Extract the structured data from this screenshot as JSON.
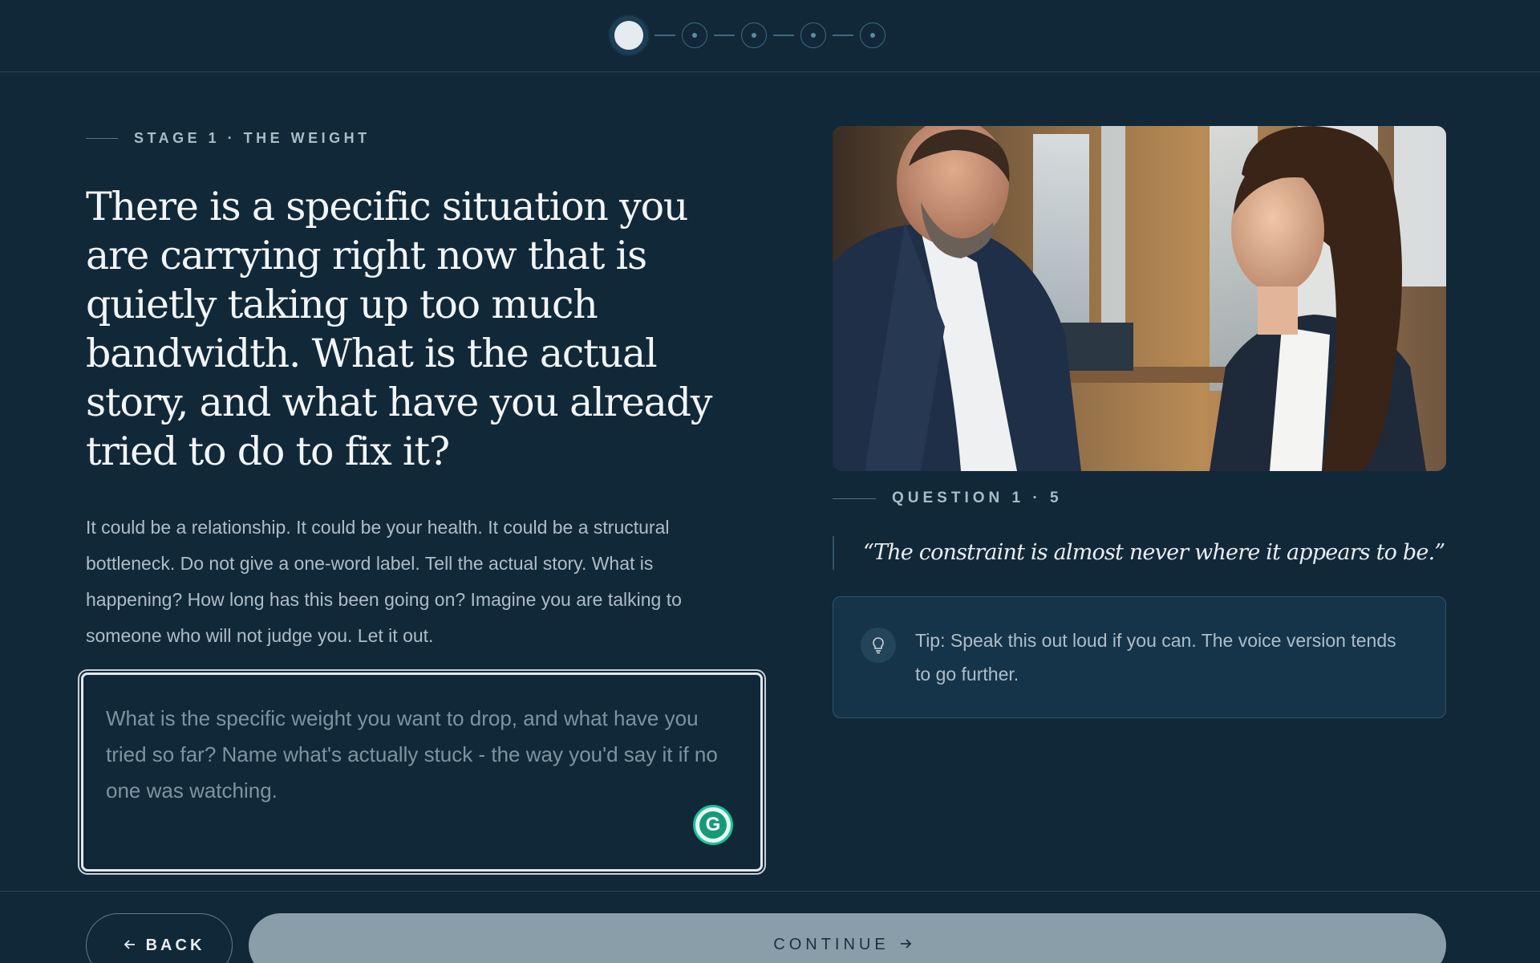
{
  "stepper": {
    "total_steps": 5,
    "current_step": 1
  },
  "stage": {
    "eyebrow": "STAGE 1 · THE WEIGHT"
  },
  "question": {
    "text": "There is a specific situation you are carrying right now that is quietly taking up too much bandwidth. What is the actual story, and what have you already tried to do to fix it?",
    "description": "It could be a relationship. It could be your health. It could be a structural bottleneck. Do not give a one-word label. Tell the actual story. What is happening? How long has this been going on? Imagine you are talking to someone who will not judge you. Let it out."
  },
  "answer": {
    "value": "",
    "placeholder": "What is the specific weight you want to drop, and what have you tried so far? Name what's actually stuck - the way you'd say it if no one was watching."
  },
  "sidebar": {
    "question_counter": "QUESTION 1 · 5",
    "quote": "“The constraint is almost never where it appears to be.”",
    "tip": "Tip: Speak this out loud if you can. The voice version tends to go further."
  },
  "footer": {
    "back_label": "BACK",
    "continue_label": "CONTINUE"
  },
  "icons": {
    "back": "arrow-left-icon",
    "continue": "arrow-right-icon",
    "tip": "lightbulb-icon",
    "grammarly": "grammarly-icon"
  },
  "colors": {
    "background": "#112838",
    "continue_button": "#8a9ea9",
    "text_primary": "#f2f5f7",
    "text_muted": "#aebdc8"
  }
}
